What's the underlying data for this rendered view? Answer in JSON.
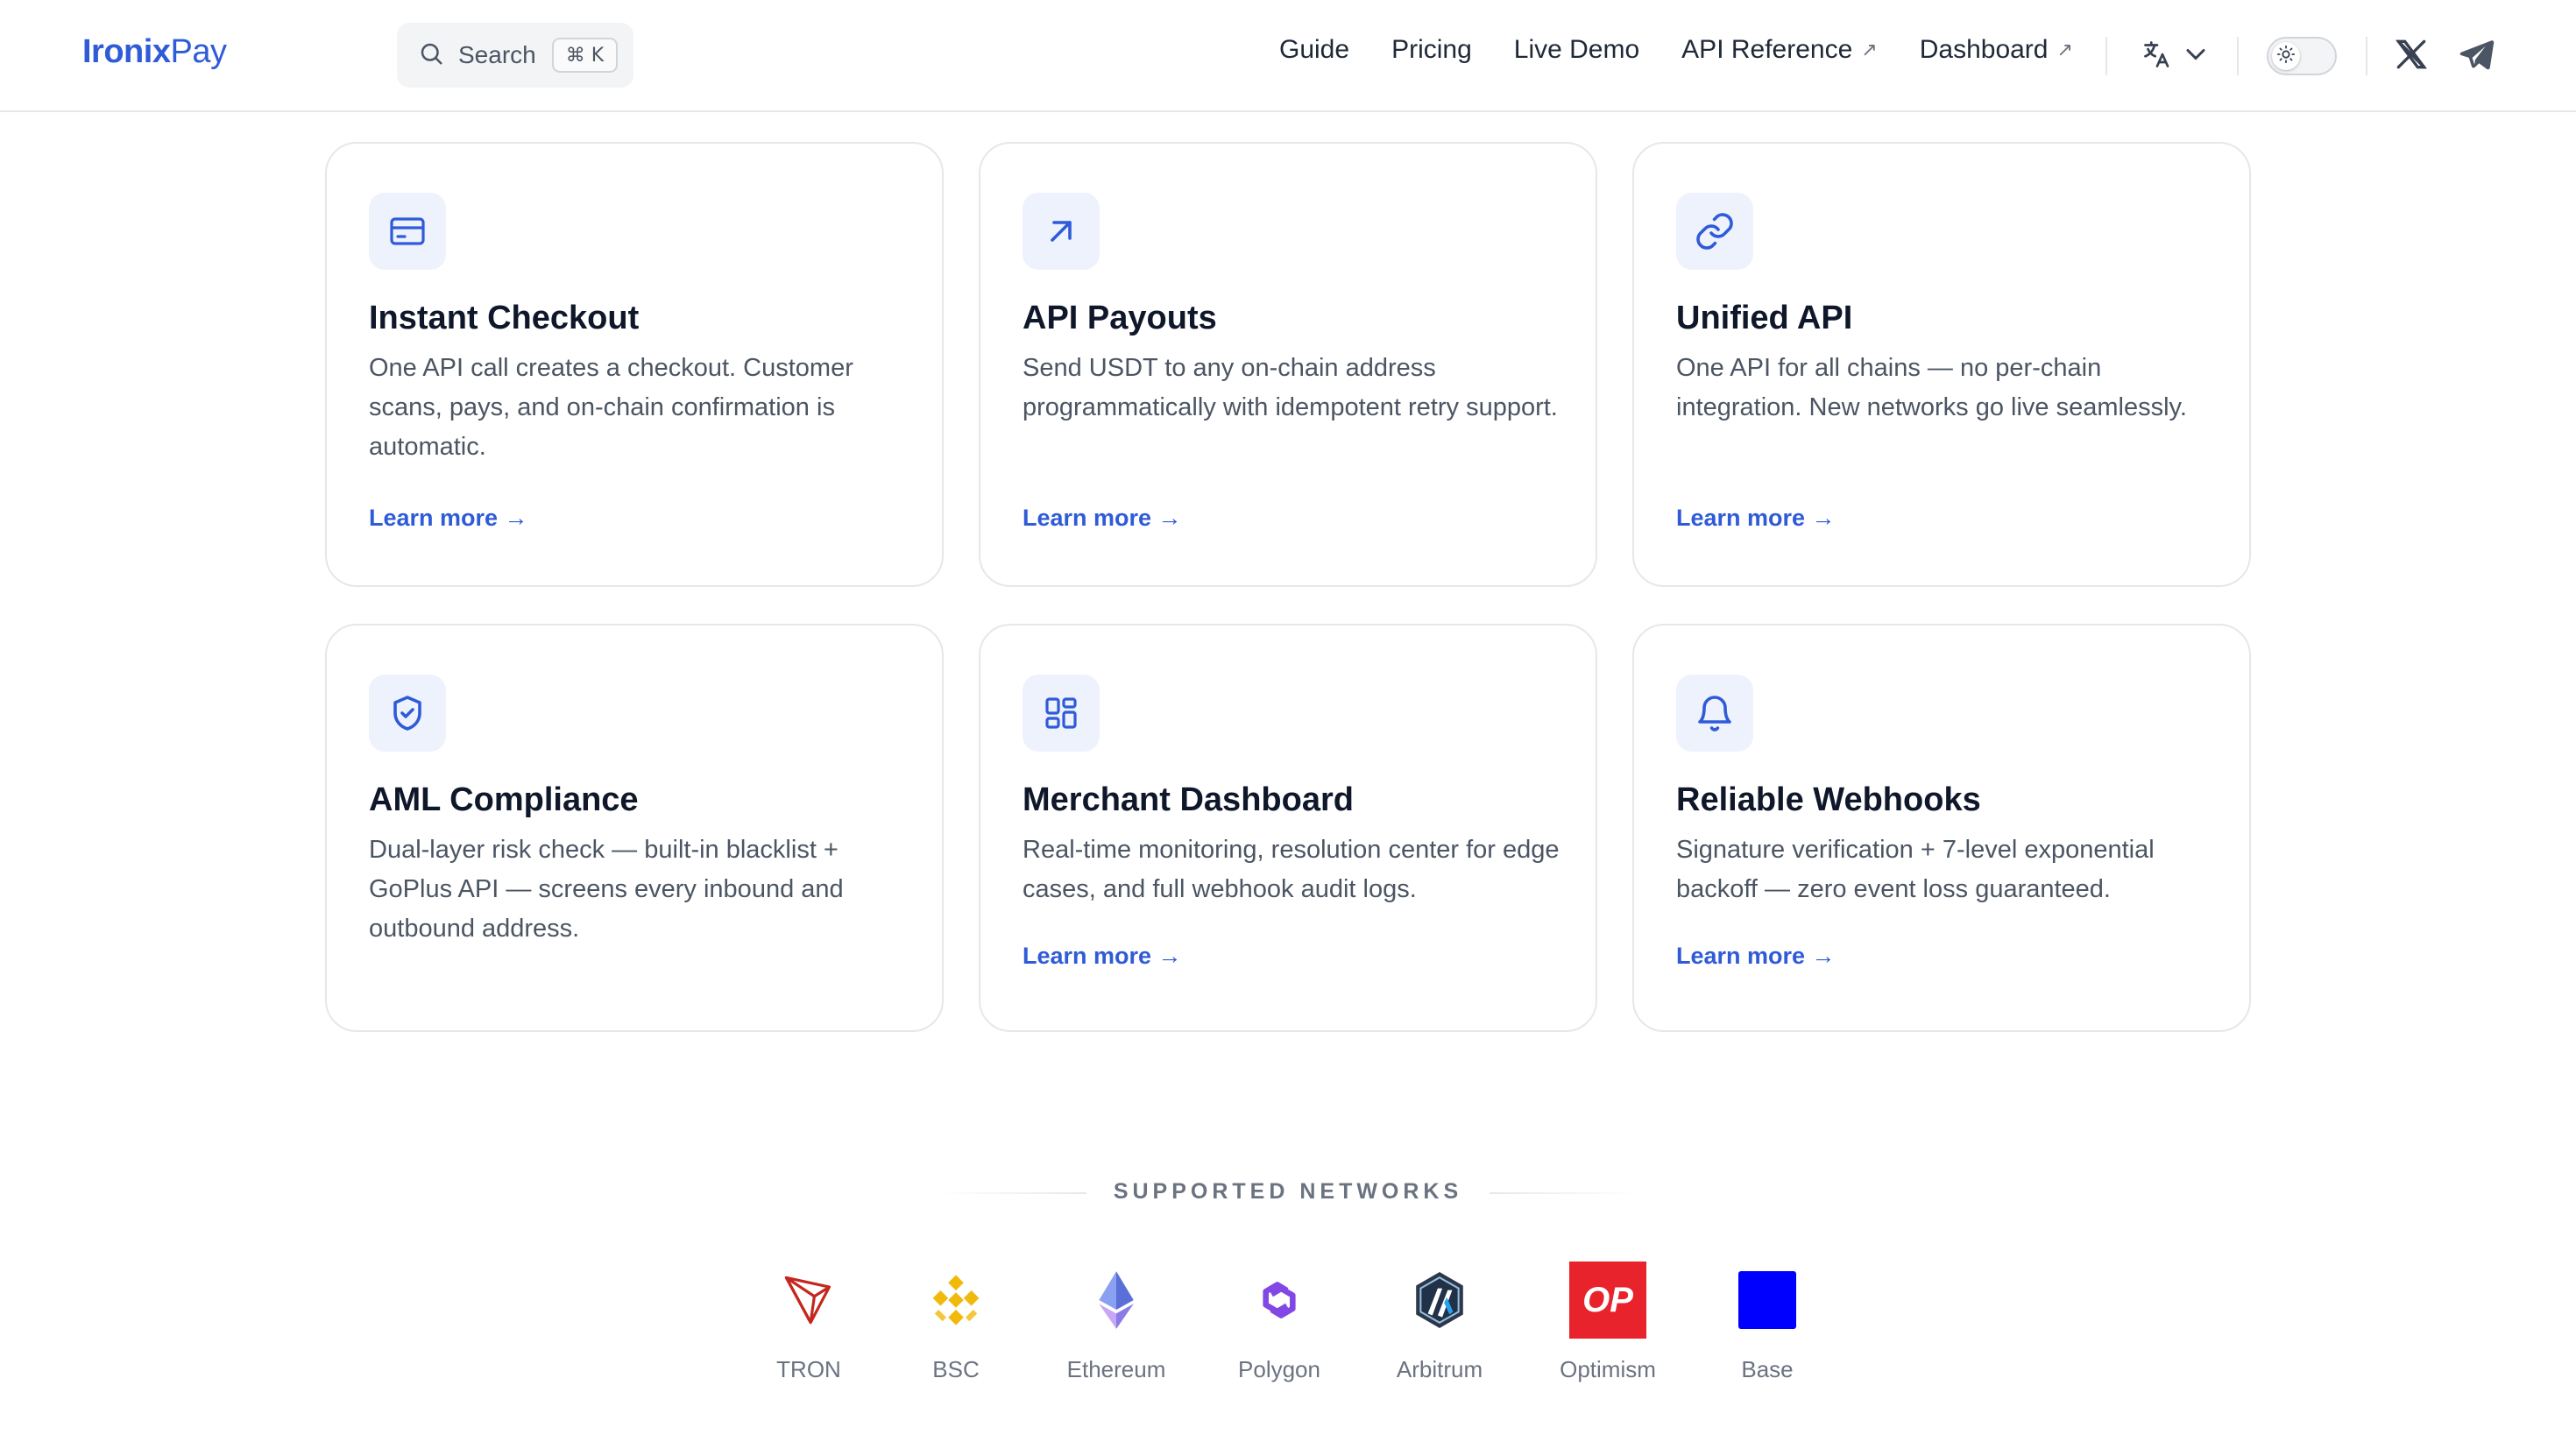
{
  "header": {
    "logo_primary": "Ironix",
    "logo_secondary": "Pay",
    "search_label": "Search",
    "search_shortcut": "⌘ K",
    "nav": [
      {
        "label": "Guide"
      },
      {
        "label": "Pricing"
      },
      {
        "label": "Live Demo"
      },
      {
        "label": "API Reference",
        "ext": "↗"
      },
      {
        "label": "Dashboard",
        "ext": "↗"
      }
    ],
    "icons": {
      "language": "translate-icon",
      "theme": "sun-icon",
      "x": "x-twitter-icon",
      "telegram": "telegram-icon"
    }
  },
  "features": [
    {
      "icon": "credit-card-icon",
      "title": "Instant Checkout",
      "description": "One API call creates a checkout. Customer scans, pays, and on-chain confirmation is automatic.",
      "link": "Learn more →"
    },
    {
      "icon": "arrow-up-right-icon",
      "title": "API Payouts",
      "description": "Send USDT to any on-chain address programmatically with idempotent retry support.",
      "link": "Learn more →"
    },
    {
      "icon": "link-icon",
      "title": "Unified API",
      "description": "One API for all chains — no per-chain integration. New networks go live seamlessly.",
      "link": "Learn more →"
    },
    {
      "icon": "shield-check-icon",
      "title": "AML Compliance",
      "description": "Dual-layer risk check — built-in blacklist + GoPlus API — screens every inbound and outbound address.",
      "link": ""
    },
    {
      "icon": "dashboard-grid-icon",
      "title": "Merchant Dashboard",
      "description": "Real-time monitoring, resolution center for edge cases, and full webhook audit logs.",
      "link": "Learn more →"
    },
    {
      "icon": "bell-icon",
      "title": "Reliable Webhooks",
      "description": "Signature verification + 7-level exponential backoff — zero event loss guaranteed.",
      "link": "Learn more →"
    }
  ],
  "networks": {
    "heading": "SUPPORTED NETWORKS",
    "items": [
      {
        "name": "TRON",
        "icon": "tron-logo"
      },
      {
        "name": "BSC",
        "icon": "bsc-logo"
      },
      {
        "name": "Ethereum",
        "icon": "ethereum-logo"
      },
      {
        "name": "Polygon",
        "icon": "polygon-logo"
      },
      {
        "name": "Arbitrum",
        "icon": "arbitrum-logo"
      },
      {
        "name": "Optimism",
        "icon": "optimism-logo",
        "badge": "OP"
      },
      {
        "name": "Base",
        "icon": "base-logo"
      }
    ]
  },
  "colors": {
    "accent": "#2f5bd8",
    "icon_bg": "#eef2fd",
    "border": "#e5e7eb",
    "tron": "#c4271d",
    "bsc": "#f0b90b",
    "polygon": "#8247e5",
    "optimism": "#ff0420",
    "base": "#0000ff"
  }
}
